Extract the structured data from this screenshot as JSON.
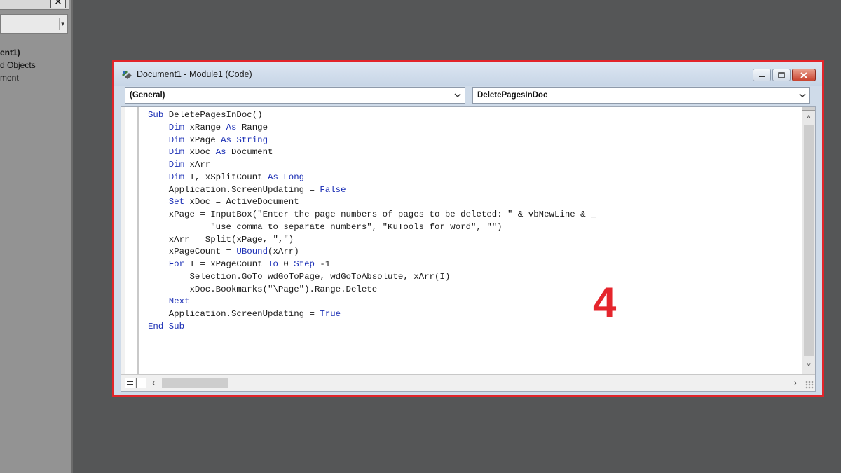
{
  "project_explorer": {
    "close_glyph": "✕",
    "tree_items": [
      "ent1)",
      "d Objects",
      "ment"
    ]
  },
  "code_window": {
    "title": "Document1 - Module1 (Code)",
    "object_combo": "(General)",
    "procedure_combo": "DeletePagesInDoc",
    "code_lines": [
      [
        {
          "t": "Sub",
          "kw": true
        },
        {
          "t": " DeletePagesInDoc()"
        }
      ],
      [
        {
          "t": "    "
        },
        {
          "t": "Dim",
          "kw": true
        },
        {
          "t": " xRange "
        },
        {
          "t": "As",
          "kw": true
        },
        {
          "t": " Range"
        }
      ],
      [
        {
          "t": "    "
        },
        {
          "t": "Dim",
          "kw": true
        },
        {
          "t": " xPage "
        },
        {
          "t": "As String",
          "kw": true
        }
      ],
      [
        {
          "t": "    "
        },
        {
          "t": "Dim",
          "kw": true
        },
        {
          "t": " xDoc "
        },
        {
          "t": "As",
          "kw": true
        },
        {
          "t": " Document"
        }
      ],
      [
        {
          "t": "    "
        },
        {
          "t": "Dim",
          "kw": true
        },
        {
          "t": " xArr"
        }
      ],
      [
        {
          "t": "    "
        },
        {
          "t": "Dim",
          "kw": true
        },
        {
          "t": " I, xSplitCount "
        },
        {
          "t": "As Long",
          "kw": true
        }
      ],
      [
        {
          "t": "    Application.ScreenUpdating = "
        },
        {
          "t": "False",
          "kw": true
        }
      ],
      [
        {
          "t": "    "
        },
        {
          "t": "Set",
          "kw": true
        },
        {
          "t": " xDoc = ActiveDocument"
        }
      ],
      [
        {
          "t": "    xPage = InputBox(\"Enter the page numbers of pages to be deleted: \" & vbNewLine & _"
        }
      ],
      [
        {
          "t": "            \"use comma to separate numbers\", \"KuTools for Word\", \"\")"
        }
      ],
      [
        {
          "t": "    xArr = Split(xPage, \",\")"
        }
      ],
      [
        {
          "t": "    xPageCount = "
        },
        {
          "t": "UBound",
          "kw": true
        },
        {
          "t": "(xArr)"
        }
      ],
      [
        {
          "t": "    "
        },
        {
          "t": "For",
          "kw": true
        },
        {
          "t": " I = xPageCount "
        },
        {
          "t": "To",
          "kw": true
        },
        {
          "t": " 0 "
        },
        {
          "t": "Step",
          "kw": true
        },
        {
          "t": " -1"
        }
      ],
      [
        {
          "t": "        Selection.GoTo wdGoToPage, wdGoToAbsolute, xArr(I)"
        }
      ],
      [
        {
          "t": "        xDoc.Bookmarks(\"\\Page\").Range.Delete"
        }
      ],
      [
        {
          "t": "    "
        },
        {
          "t": "Next",
          "kw": true
        }
      ],
      [
        {
          "t": "    Application.ScreenUpdating = "
        },
        {
          "t": "True",
          "kw": true
        }
      ],
      [
        {
          "t": "End Sub",
          "kw": true
        }
      ]
    ]
  },
  "annotation": {
    "step_number": "4"
  },
  "colors": {
    "keyword": "#1b2fb5",
    "highlight_border": "#e2242a",
    "step_number": "#e5252c"
  }
}
